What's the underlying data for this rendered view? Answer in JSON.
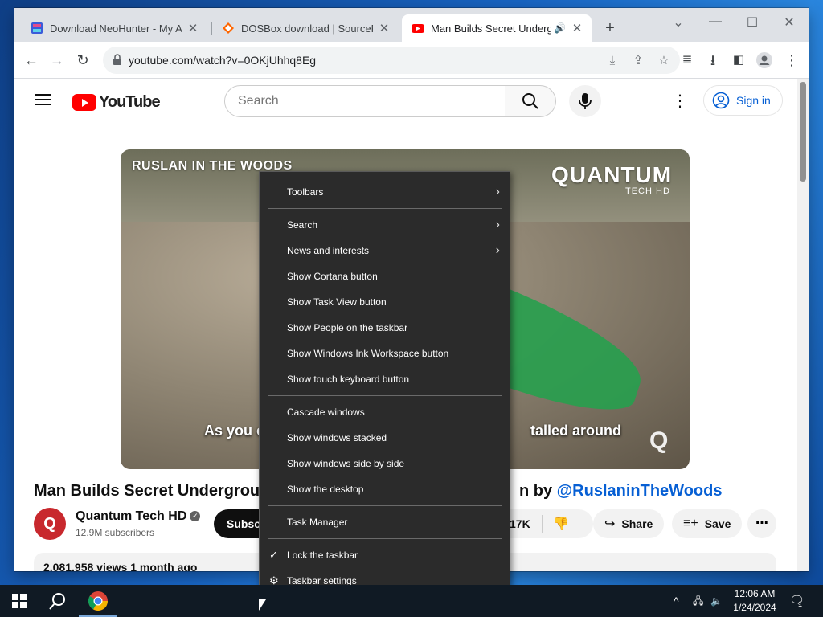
{
  "browser": {
    "tabs": [
      {
        "title": "Download NeoHunter - My Aba",
        "favicon": "neohunter-icon",
        "active": false
      },
      {
        "title": "DOSBox download | SourceForg",
        "favicon": "sourceforge-icon",
        "active": false
      },
      {
        "title": "Man Builds Secret Undergro",
        "favicon": "youtube-icon",
        "active": true
      }
    ],
    "url": "youtube.com/watch?v=0OKjUhhq8Eg"
  },
  "youtube": {
    "logo_text": "YouTube",
    "search_placeholder": "Search",
    "signin_label": "Sign in",
    "video": {
      "overlay_top_left": "RUSLAN IN THE WOODS",
      "brand": "QUANTUM",
      "brand_sub": "TECH HD",
      "caption_left": "As you c",
      "caption_right": "talled around",
      "watermark": "Q"
    },
    "title_left": "Man Builds Secret Undergroun",
    "title_right_prefix": "n by ",
    "title_right_link": "@RuslaninTheWoods",
    "channel": {
      "avatar_letter": "Q",
      "name": "Quantum Tech HD",
      "verified": "✓",
      "subscribers": "12.9M subscribers",
      "subscribe_label": "Subscr"
    },
    "likes": "17K",
    "share_label": "Share",
    "save_label": "Save",
    "more_label": "⋯",
    "description": "2,081,958 views  1 month ago"
  },
  "context_menu": {
    "items": [
      {
        "label": "Toolbars",
        "submenu": true
      },
      {
        "label": "Search",
        "submenu": true
      },
      {
        "label": "News and interests",
        "submenu": true
      },
      {
        "label": "Show Cortana button"
      },
      {
        "label": "Show Task View button"
      },
      {
        "label": "Show People on the taskbar"
      },
      {
        "label": "Show Windows Ink Workspace button"
      },
      {
        "label": "Show touch keyboard button"
      },
      {
        "label": "Cascade windows"
      },
      {
        "label": "Show windows stacked"
      },
      {
        "label": "Show windows side by side"
      },
      {
        "label": "Show the desktop"
      },
      {
        "label": "Task Manager"
      },
      {
        "label": "Lock the taskbar",
        "checked": true
      },
      {
        "label": "Taskbar settings",
        "icon": "gear-icon"
      }
    ]
  },
  "taskbar": {
    "time": "12:06 AM",
    "date": "1/24/2024",
    "notification_count": "1"
  },
  "colors": {
    "youtube_red": "#ff0000",
    "link_blue": "#065fd4",
    "menu_bg": "#2b2b2b",
    "taskbar_bg": "#101a24"
  }
}
